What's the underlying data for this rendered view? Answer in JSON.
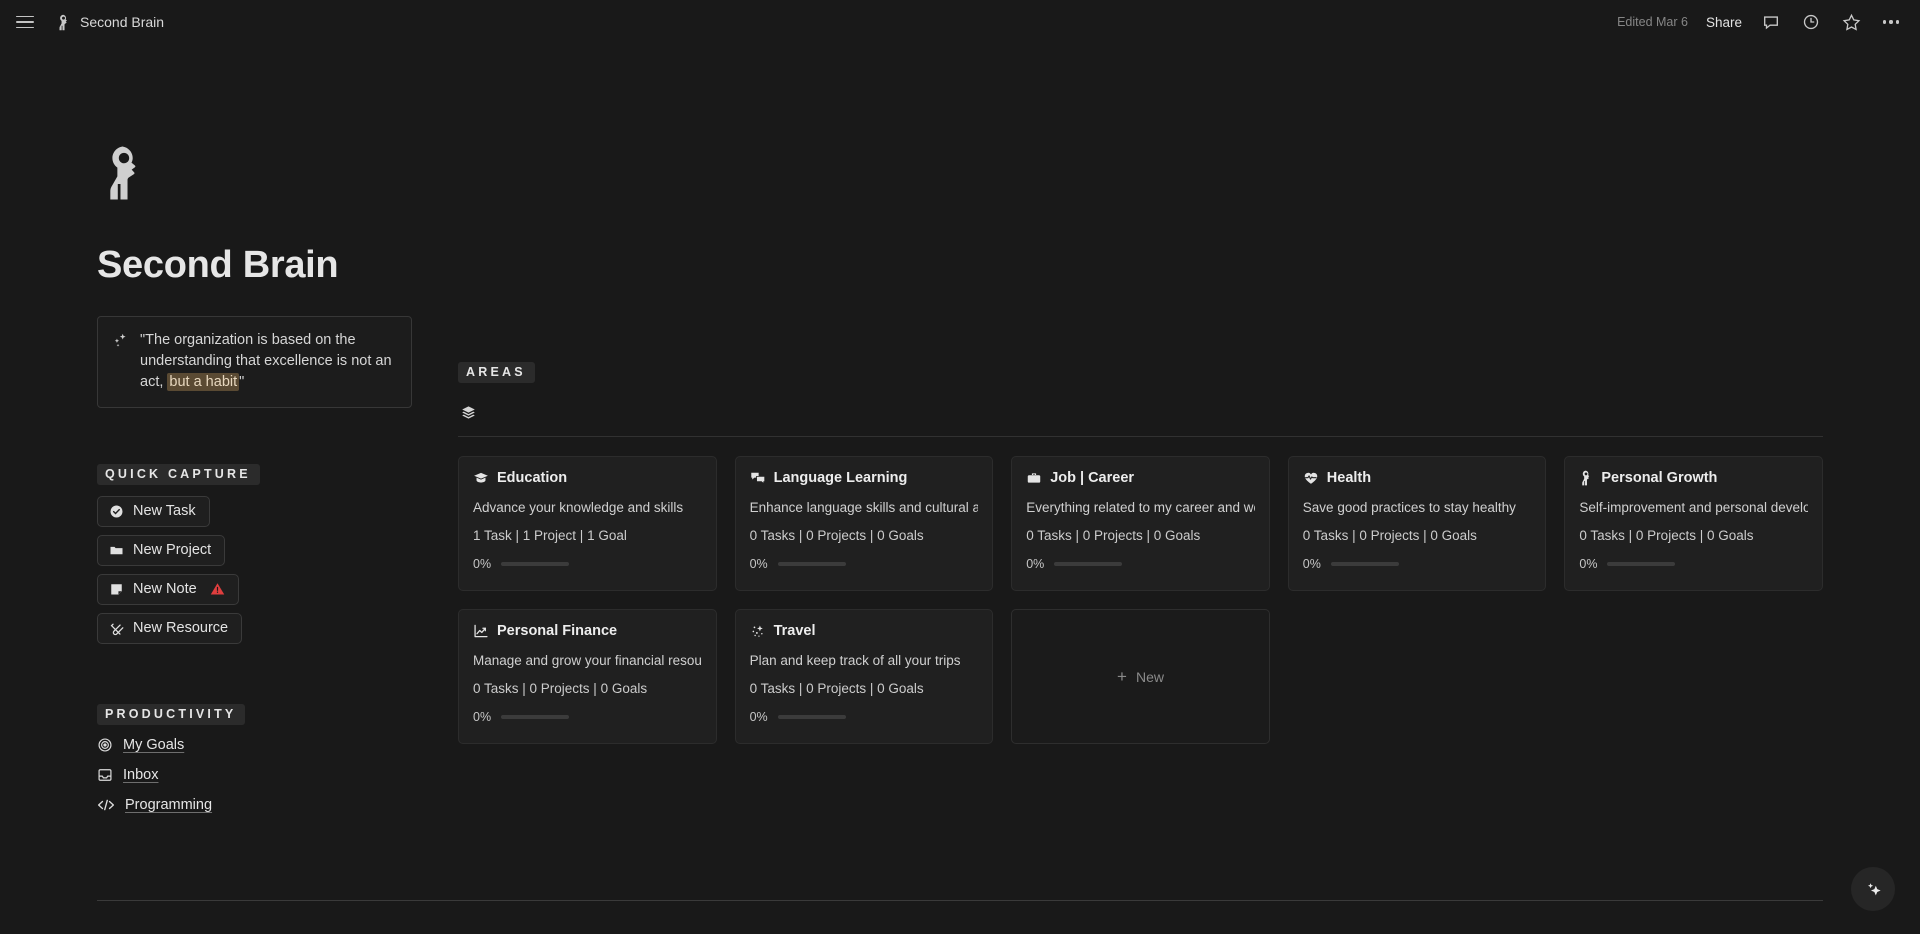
{
  "topbar": {
    "menu_icon": "hamburger-menu-icon",
    "workspace_icon": "head-keyhole-icon",
    "title": "Second Brain",
    "edited": "Edited Mar 6",
    "share_label": "Share",
    "comment_icon": "comment-icon",
    "history_icon": "clock-history-icon",
    "favorite_icon": "star-icon",
    "more_icon": "more-options-icon"
  },
  "page": {
    "icon": "head-keyhole-icon",
    "title": "Second Brain"
  },
  "callout": {
    "icon": "sparkles-icon",
    "text_before": "\"The organization is based on the understanding that excellence is not an act, ",
    "highlight": "but a habit",
    "text_after": "\"",
    "highlight_color": "#5a4a33"
  },
  "quick_capture": {
    "heading": "QUICK CAPTURE",
    "items": [
      {
        "label": "New Task",
        "icon": "check-circle-icon",
        "warning": false
      },
      {
        "label": "New Project",
        "icon": "folder-icon",
        "warning": false
      },
      {
        "label": "New Note",
        "icon": "note-icon",
        "warning": true,
        "warning_icon": "warning-triangle-icon",
        "warning_color": "#e03e3e"
      },
      {
        "label": "New Resource",
        "icon": "paperclip-icon",
        "warning": false
      }
    ]
  },
  "productivity": {
    "heading": "PRODUCTIVITY",
    "items": [
      {
        "label": "My Goals",
        "icon": "target-icon"
      },
      {
        "label": "Inbox",
        "icon": "inbox-tray-icon"
      },
      {
        "label": "Programming",
        "icon": "code-brackets-icon"
      }
    ]
  },
  "areas": {
    "heading": "AREAS",
    "view_icon": "layers-stack-icon",
    "new_card": {
      "label": "New",
      "icon": "plus-icon"
    },
    "cards": [
      {
        "title": "Education",
        "icon": "graduation-cap-icon",
        "description": "Advance your knowledge and skills",
        "stats": "1 Task | 1 Project | 1 Goal",
        "progress": "0%",
        "progress_value": 0
      },
      {
        "title": "Language Learning",
        "icon": "speech-bubbles-icon",
        "description": "Enhance language skills and cultural awareness",
        "stats": "0 Tasks | 0 Projects | 0 Goals",
        "progress": "0%",
        "progress_value": 0
      },
      {
        "title": "Job | Career",
        "icon": "briefcase-icon",
        "description": "Everything related to my career and work",
        "stats": "0 Tasks | 0 Projects | 0 Goals",
        "progress": "0%",
        "progress_value": 0
      },
      {
        "title": "Health",
        "icon": "heart-pulse-icon",
        "description": "Save good practices to stay healthy",
        "stats": "0 Tasks | 0 Projects | 0 Goals",
        "progress": "0%",
        "progress_value": 0
      },
      {
        "title": "Personal Growth",
        "icon": "head-keyhole-icon",
        "description": "Self-improvement and personal development",
        "stats": "0 Tasks | 0 Projects | 0 Goals",
        "progress": "0%",
        "progress_value": 0
      },
      {
        "title": "Personal Finance",
        "icon": "chart-trend-icon",
        "description": "Manage and grow your financial resources",
        "stats": "0 Tasks | 0 Projects | 0 Goals",
        "progress": "0%",
        "progress_value": 0
      },
      {
        "title": "Travel",
        "icon": "sparkle-burst-icon",
        "description": "Plan and keep track of all your trips",
        "stats": "0 Tasks | 0 Projects | 0 Goals",
        "progress": "0%",
        "progress_value": 0
      }
    ]
  },
  "fab": {
    "icon": "ai-sparkle-icon"
  },
  "colors": {
    "background": "#191919",
    "card_background": "#202020",
    "accent_highlight": "#5a4a33",
    "warning": "#e03e3e"
  }
}
